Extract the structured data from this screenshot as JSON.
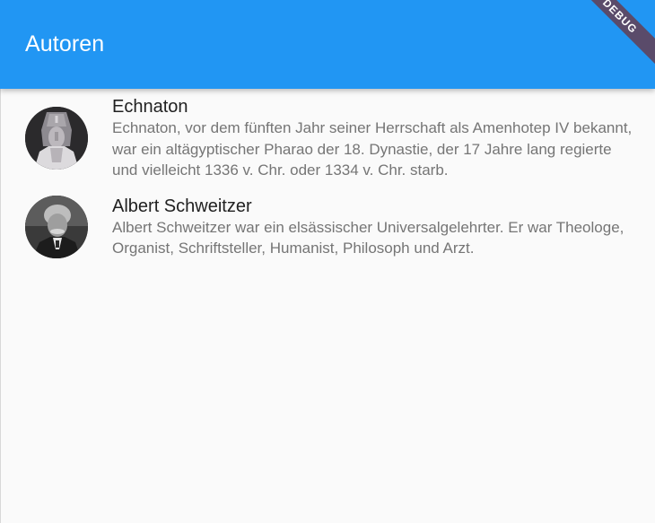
{
  "appbar": {
    "title": "Autoren",
    "color": "#2196f3",
    "debug_banner": "DEBUG"
  },
  "authors": [
    {
      "name": "Echnaton",
      "description": "Echnaton, vor dem fünften Jahr seiner Herrschaft als Amenhotep IV bekannt, war ein altägyptischer Pharao der 18. Dynastie, der 17 Jahre lang regierte und vielleicht 1336 v. Chr. oder 1334 v. Chr. starb.",
      "avatar": "pharaoh-statue-portrait"
    },
    {
      "name": "Albert Schweitzer",
      "description": "Albert Schweitzer war ein elsässischer Universalgelehrter. Er war Theologe, Organist, Schriftsteller, Humanist, Philosoph und Arzt.",
      "avatar": "bw-photo-portrait"
    }
  ]
}
